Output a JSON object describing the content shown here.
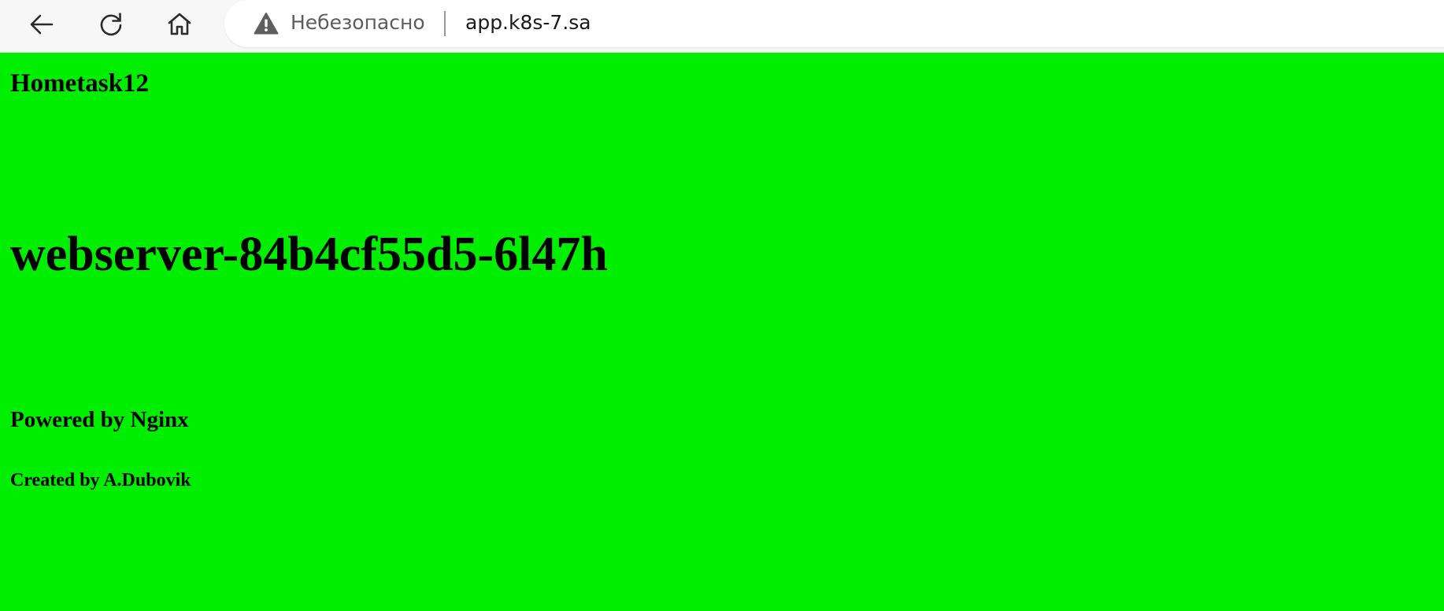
{
  "browser": {
    "nav": {
      "back_icon": "arrow-left-icon",
      "reload_icon": "reload-icon",
      "home_icon": "home-icon"
    },
    "address_bar": {
      "security_icon": "warning-triangle-icon",
      "security_label": "Небезопасно",
      "url": "app.k8s-7.sa"
    }
  },
  "page": {
    "background_color": "#00ee00",
    "title": "Hometask12",
    "hostname": "webserver-84b4cf55d5-6l47h",
    "powered_by": "Powered by Nginx",
    "created_by": "Created by A.Dubovik"
  }
}
